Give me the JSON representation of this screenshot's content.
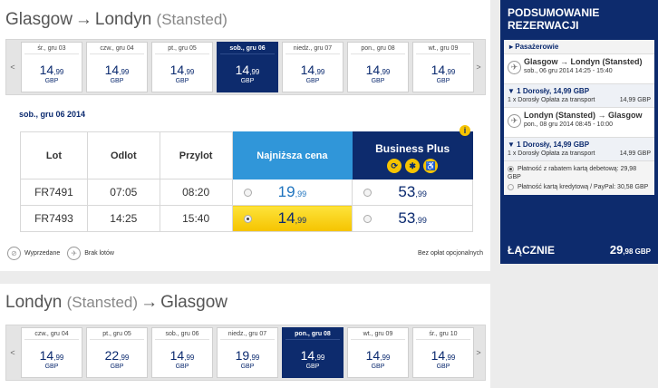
{
  "outbound": {
    "from": "Glasgow",
    "to": "Londyn",
    "to_sub": "(Stansted)",
    "selected_date": "sob., gru 06 2014",
    "days": [
      {
        "label": "śr., gru 03",
        "int": "14",
        "dec": ",99",
        "cur": "GBP",
        "selected": false
      },
      {
        "label": "czw., gru 04",
        "int": "14",
        "dec": ",99",
        "cur": "GBP",
        "selected": false
      },
      {
        "label": "pt., gru 05",
        "int": "14",
        "dec": ",99",
        "cur": "GBP",
        "selected": false
      },
      {
        "label": "sob., gru 06",
        "int": "14",
        "dec": ",99",
        "cur": "GBP",
        "selected": true
      },
      {
        "label": "niedz., gru 07",
        "int": "14",
        "dec": ",99",
        "cur": "GBP",
        "selected": false
      },
      {
        "label": "pon., gru 08",
        "int": "14",
        "dec": ",99",
        "cur": "GBP",
        "selected": false
      },
      {
        "label": "wt., gru 09",
        "int": "14",
        "dec": ",99",
        "cur": "GBP",
        "selected": false
      }
    ],
    "table": {
      "col_flight": "Lot",
      "col_depart": "Odlot",
      "col_arrive": "Przylot",
      "col_lowest": "Najniższa cena",
      "col_business": "Business Plus",
      "business_icons": [
        "priority-icon",
        "fast-track-icon",
        "wheelchair-icon"
      ],
      "rows": [
        {
          "flight": "FR7491",
          "depart": "07:05",
          "arrive": "08:20",
          "low_int": "19",
          "low_dec": ",99",
          "biz_int": "53",
          "biz_dec": ",99",
          "low_selected": false
        },
        {
          "flight": "FR7493",
          "depart": "14:25",
          "arrive": "15:40",
          "low_int": "14",
          "low_dec": ",99",
          "biz_int": "53",
          "biz_dec": ",99",
          "low_selected": true
        }
      ]
    },
    "legend_soldout": "Wyprzedane",
    "legend_noflights": "Brak lotów",
    "no_fees": "Bez opłat opcjonalnych"
  },
  "inbound": {
    "from": "Londyn",
    "from_sub": "(Stansted)",
    "to": "Glasgow",
    "days": [
      {
        "label": "czw., gru 04",
        "int": "14",
        "dec": ",99",
        "cur": "GBP",
        "selected": false
      },
      {
        "label": "pt., gru 05",
        "int": "22",
        "dec": ",99",
        "cur": "GBP",
        "selected": false
      },
      {
        "label": "sob., gru 06",
        "int": "14",
        "dec": ",99",
        "cur": "GBP",
        "selected": false
      },
      {
        "label": "niedz., gru 07",
        "int": "19",
        "dec": ",99",
        "cur": "GBP",
        "selected": false
      },
      {
        "label": "pon., gru 08",
        "int": "14",
        "dec": ",99",
        "cur": "GBP",
        "selected": true
      },
      {
        "label": "wt., gru 09",
        "int": "14",
        "dec": ",99",
        "cur": "GBP",
        "selected": false
      },
      {
        "label": "śr., gru 10",
        "int": "14",
        "dec": ",99",
        "cur": "GBP",
        "selected": false
      }
    ]
  },
  "summary": {
    "title_line1": "PODSUMOWANIE",
    "title_line2": "REZERWACJI",
    "passengers": "▸ Pasażerowie",
    "legs": [
      {
        "title": "Glasgow → Londyn (Stansted)",
        "sub": "sob., 06 gru 2014 14:25 - 15:40",
        "adult": "▼ 1 Dorosły, 14,99 GBP",
        "fee_label": "1 x Dorosły Opłata za transport",
        "fee_value": "14,99 GBP"
      },
      {
        "title": "Londyn (Stansted) → Glasgow",
        "sub": "pon., 08 gru 2014 08:45 - 10:00",
        "adult": "▼ 1 Dorosły, 14,99 GBP",
        "fee_label": "1 x Dorosły Opłata za transport",
        "fee_value": "14,99 GBP"
      }
    ],
    "payment_debit": "Płatność z rabatem kartą debetową: 29,98 GBP",
    "payment_credit": "Płatność kartą kredytową / PayPal: 30,58 GBP",
    "total_label": "ŁĄCZNIE",
    "total_int": "29",
    "total_dec": ",98 GBP"
  },
  "colors": {
    "navy": "#0d2b6d",
    "lowest_header": "#3096d9",
    "selected_fare": "#f5c300",
    "price_blue": "#1e73be"
  }
}
